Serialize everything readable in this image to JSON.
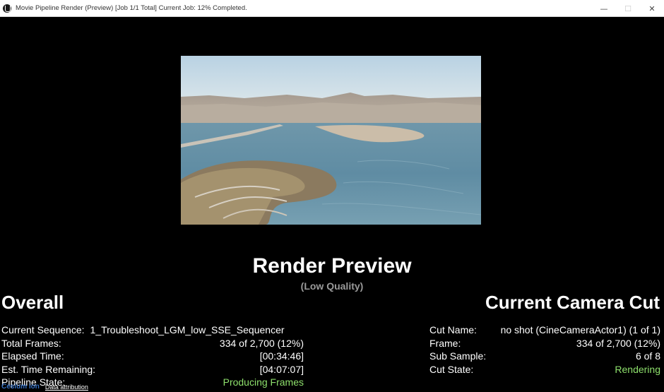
{
  "window": {
    "title": "Movie Pipeline Render (Preview) [Job 1/1 Total] Current Job: 12% Completed.",
    "app_icon": "unreal-logo-icon",
    "controls": {
      "minimize": "—",
      "maximize": "☐",
      "close": "✕"
    }
  },
  "preview": {
    "heading": "Render Preview",
    "quality": "(Low Quality)"
  },
  "overall": {
    "title": "Overall",
    "rows": [
      {
        "label": "Current Sequence:",
        "value": "1_Troubleshoot_LGM_low_SSE_Sequencer"
      },
      {
        "label": "Total Frames:",
        "value": "334 of 2,700 (12%)"
      },
      {
        "label": "Elapsed Time:",
        "value": "[00:34:46]"
      },
      {
        "label": "Est. Time Remaining:",
        "value": "[04:07:07]"
      },
      {
        "label": "Pipeline State:",
        "value": "Producing Frames"
      }
    ]
  },
  "camera_cut": {
    "title": "Current Camera Cut",
    "rows": [
      {
        "label": "Cut Name:",
        "value": "no shot (CineCameraActor1) (1 of 1)"
      },
      {
        "label": "Frame:",
        "value": "334 of 2,700 (12%)"
      },
      {
        "label": "Sub Sample:",
        "value": "6 of 8"
      },
      {
        "label": "Cut State:",
        "value": "Rendering"
      }
    ]
  },
  "attribution": {
    "logo": "Cesium ion",
    "link": "Data attribution"
  },
  "colors": {
    "status_green": "#8ee06c",
    "background": "#000000"
  }
}
